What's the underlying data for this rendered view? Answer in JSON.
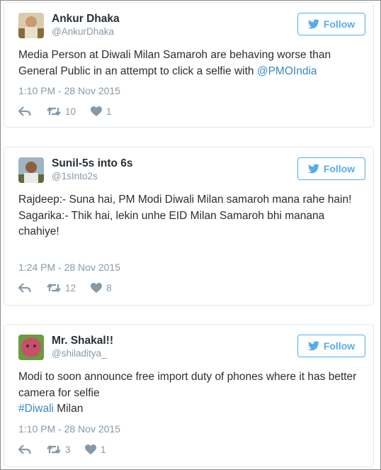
{
  "tweets": [
    {
      "name": "Ankur Dhaka",
      "handle": "@AnkurDhaka",
      "follow_label": "Follow",
      "text_plain": "Media Person at Diwali Milan Samaroh are behaving worse than General Public in an attempt to click a selfie with ",
      "mention": "@PMOIndia",
      "timestamp": "1:10 PM - 28 Nov 2015",
      "retweets": "10",
      "likes": "1"
    },
    {
      "name": "Sunil-5s into 6s",
      "handle": "@1sInto2s",
      "follow_label": "Follow",
      "line1": "Rajdeep:- Suna hai, PM Modi Diwali Milan samaroh mana rahe hain!",
      "line2": "Sagarika:- Thik hai, lekin unhe EID Milan Samaroh bhi manana chahiye!",
      "timestamp": "1:24 PM - 28 Nov 2015",
      "retweets": "12",
      "likes": "8"
    },
    {
      "name": "Mr. Shakal!!",
      "handle": "@shiladitya_",
      "follow_label": "Follow",
      "line1": "Modi to soon announce free import duty of phones where it has better camera for selfie",
      "hashtag": "#Diwali",
      "after_hashtag": " Milan",
      "timestamp": "1:10 PM - 28 Nov 2015",
      "retweets": "3",
      "likes": "1"
    }
  ],
  "icons": {
    "reply": "reply-arrow-icon",
    "retweet": "retweet-icon",
    "like": "heart-icon",
    "bird": "twitter-bird-icon"
  },
  "colors": {
    "accent": "#55acee",
    "link": "#3b88c3",
    "muted": "#8899a6",
    "text": "#292f33"
  }
}
